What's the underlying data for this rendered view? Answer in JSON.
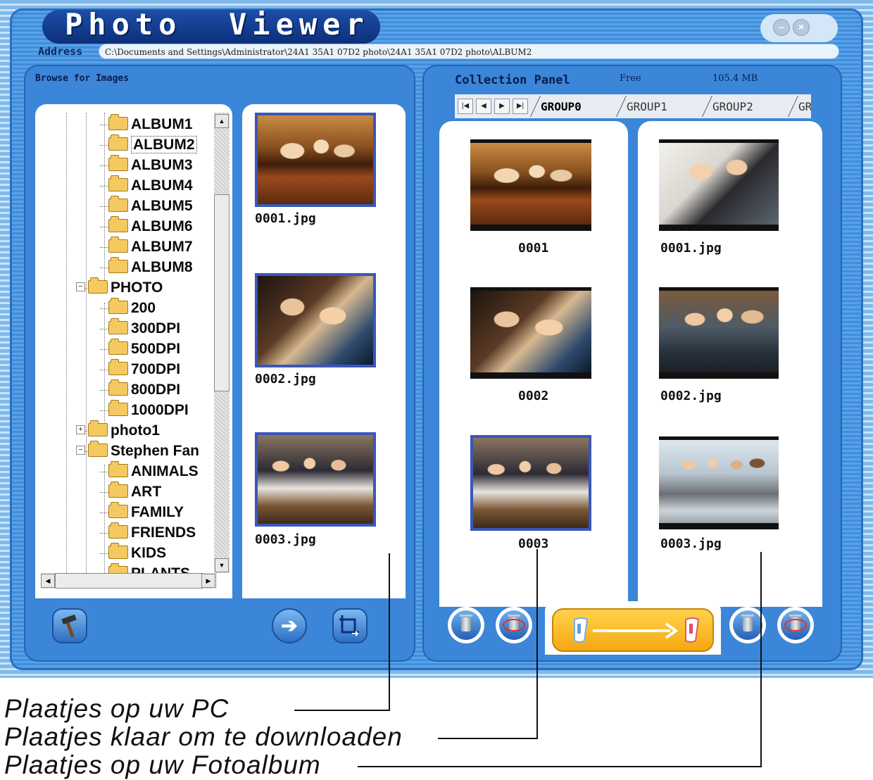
{
  "window": {
    "title": "Photo  Viewer",
    "minimize_glyph": "–",
    "close_glyph": "×"
  },
  "address": {
    "label": "Address",
    "value": "C:\\Documents and Settings\\Administrator\\24A1 35A1 07D2 photo\\24A1 35A1 07D2 photo\\ALBUM2"
  },
  "left_panel": {
    "caption": "Browse for  Images",
    "tree": [
      {
        "label": "ALBUM1"
      },
      {
        "label": "ALBUM2",
        "selected": true
      },
      {
        "label": "ALBUM3"
      },
      {
        "label": "ALBUM4"
      },
      {
        "label": "ALBUM5"
      },
      {
        "label": "ALBUM6"
      },
      {
        "label": "ALBUM7"
      },
      {
        "label": "ALBUM8"
      },
      {
        "label": "PHOTO",
        "expander": "−"
      },
      {
        "label": "200"
      },
      {
        "label": "300DPI"
      },
      {
        "label": "500DPI"
      },
      {
        "label": "700DPI"
      },
      {
        "label": "800DPI"
      },
      {
        "label": "1000DPI"
      },
      {
        "label": "photo1",
        "expander": "+"
      },
      {
        "label": "Stephen Fan",
        "expander": "−"
      },
      {
        "label": "ANIMALS"
      },
      {
        "label": "ART"
      },
      {
        "label": "FAMILY"
      },
      {
        "label": "FRIENDS"
      },
      {
        "label": "KIDS"
      },
      {
        "label": "PLANTS"
      }
    ],
    "scroll_up": "▲",
    "scroll_down": "▼",
    "scroll_left": "◀",
    "scroll_right": "▶",
    "thumbnails": [
      {
        "caption": "0001.jpg"
      },
      {
        "caption": "0002.jpg"
      },
      {
        "caption": "0003.jpg"
      }
    ],
    "buttons": {
      "tool_icon": "hammer-icon",
      "arrow_glyph": "➔",
      "crop_icon": "crop-icon"
    }
  },
  "right_panel": {
    "title": "Collection Panel",
    "free_label": "Free",
    "free_value": "105.4 MB",
    "nav": [
      "|◀",
      "◀",
      "▶",
      "▶|"
    ],
    "tabs": [
      "GROUP0",
      "GROUP1",
      "GROUP2",
      "GR"
    ],
    "active_tab": "GROUP0",
    "download_items": [
      {
        "caption": "0001"
      },
      {
        "caption": "0002"
      },
      {
        "caption": "0003"
      }
    ],
    "album_items": [
      {
        "caption": "0001.jpg"
      },
      {
        "caption": "0002.jpg"
      },
      {
        "caption": "0003.jpg"
      }
    ],
    "transfer_arrow": "⟶"
  },
  "callouts": [
    {
      "text": "Plaatjes op uw PC"
    },
    {
      "text": "Plaatjes klaar om te downloaden"
    },
    {
      "text": "Plaatjes op uw Fotoalbum"
    }
  ],
  "colors": {
    "title_bar": "#0d2f7a",
    "panel": "#3b86d8",
    "transfer": "#f5a812",
    "selection_border": "#3a57b8"
  }
}
